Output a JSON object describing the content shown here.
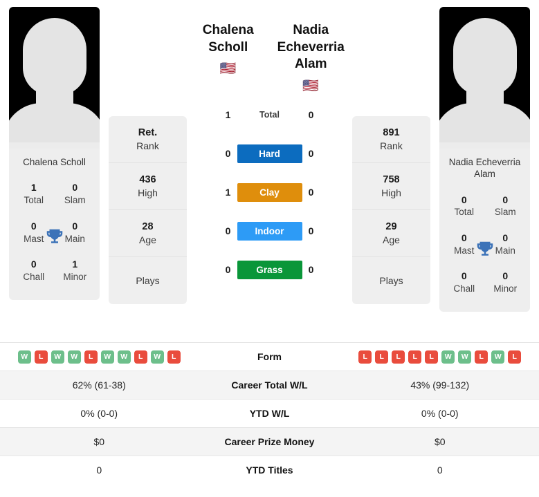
{
  "left_player": {
    "name_line1": "Chalena",
    "name_line2": "Scholl",
    "full_name": "Chalena Scholl",
    "flag": "🇺🇸",
    "stats": [
      {
        "value": "Ret.",
        "label": "Rank"
      },
      {
        "value": "436",
        "label": "High"
      },
      {
        "value": "28",
        "label": "Age"
      },
      {
        "value": "",
        "label": "Plays"
      }
    ],
    "titles": [
      {
        "value": "1",
        "label": "Total"
      },
      {
        "value": "0",
        "label": "Slam"
      },
      {
        "value": "0",
        "label": "Mast"
      },
      {
        "value": "0",
        "label": "Main"
      },
      {
        "value": "0",
        "label": "Chall"
      },
      {
        "value": "1",
        "label": "Minor"
      }
    ],
    "form": [
      "W",
      "L",
      "W",
      "W",
      "L",
      "W",
      "W",
      "L",
      "W",
      "L"
    ],
    "career_wl": "62% (61-38)",
    "ytd_wl": "0% (0-0)",
    "prize_money": "$0",
    "ytd_titles": "0"
  },
  "right_player": {
    "name_line1": "Nadia",
    "name_line2": "Echeverria Alam",
    "full_name": "Nadia Echeverria Alam",
    "flag": "🇺🇸",
    "stats": [
      {
        "value": "891",
        "label": "Rank"
      },
      {
        "value": "758",
        "label": "High"
      },
      {
        "value": "29",
        "label": "Age"
      },
      {
        "value": "",
        "label": "Plays"
      }
    ],
    "titles": [
      {
        "value": "0",
        "label": "Total"
      },
      {
        "value": "0",
        "label": "Slam"
      },
      {
        "value": "0",
        "label": "Mast"
      },
      {
        "value": "0",
        "label": "Main"
      },
      {
        "value": "0",
        "label": "Chall"
      },
      {
        "value": "0",
        "label": "Minor"
      }
    ],
    "form": [
      "L",
      "L",
      "L",
      "L",
      "L",
      "W",
      "W",
      "L",
      "W",
      "L"
    ],
    "career_wl": "43% (99-132)",
    "ytd_wl": "0% (0-0)",
    "prize_money": "$0",
    "ytd_titles": "0"
  },
  "h2h": [
    {
      "surface": "Total",
      "left": "1",
      "right": "0",
      "color": "transparent",
      "text_color": "#3a3a3a"
    },
    {
      "surface": "Hard",
      "left": "0",
      "right": "0",
      "color": "#0c6cbf",
      "text_color": "#ffffff"
    },
    {
      "surface": "Clay",
      "left": "1",
      "right": "0",
      "color": "#df8e0c",
      "text_color": "#ffffff"
    },
    {
      "surface": "Indoor",
      "left": "0",
      "right": "0",
      "color": "#2d9bf6",
      "text_color": "#ffffff"
    },
    {
      "surface": "Grass",
      "left": "0",
      "right": "0",
      "color": "#0a9639",
      "text_color": "#ffffff"
    }
  ],
  "table_rows": [
    {
      "label": "Form",
      "type": "form"
    },
    {
      "label": "Career Total W/L",
      "type": "text",
      "left": "62% (61-38)",
      "right": "43% (99-132)"
    },
    {
      "label": "YTD W/L",
      "type": "text",
      "left": "0% (0-0)",
      "right": "0% (0-0)"
    },
    {
      "label": "Career Prize Money",
      "type": "text",
      "left": "$0",
      "right": "$0"
    },
    {
      "label": "YTD Titles",
      "type": "text",
      "left": "0",
      "right": "0"
    }
  ],
  "colors": {
    "win_badge": "#6dbf8b",
    "loss_badge": "#e94c3d",
    "trophy": "#3b72b8",
    "card_bg": "#efefef"
  }
}
